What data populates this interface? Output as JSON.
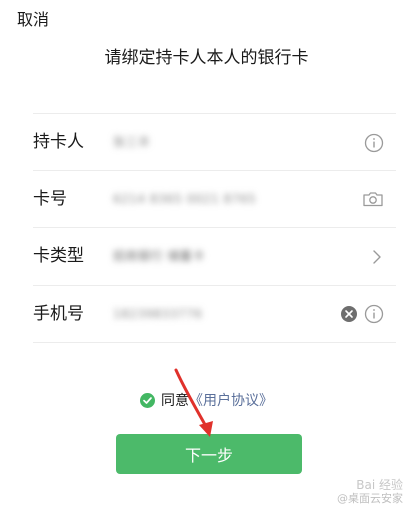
{
  "header": {
    "cancel_label": "取消",
    "title": "请绑定持卡人本人的银行卡"
  },
  "form": {
    "rows": [
      {
        "label": "持卡人",
        "value": "张三丰",
        "trailing_icons": [
          "info-icon"
        ]
      },
      {
        "label": "卡号",
        "value": "6214 8365 0021 8765",
        "trailing_icons": [
          "camera-icon"
        ]
      },
      {
        "label": "卡类型",
        "value": "招商银行 储蓄卡",
        "trailing_icons": [
          "chevron-right-icon"
        ]
      },
      {
        "label": "手机号",
        "value": "18239833776",
        "trailing_icons": [
          "clear-icon",
          "info-icon"
        ]
      }
    ]
  },
  "agreement": {
    "checked": true,
    "text": "同意",
    "link_label": "《用户协议》"
  },
  "next_button": {
    "label": "下一步"
  },
  "watermark": {
    "line1": "Bai 经验",
    "line2": "@桌面云安家"
  },
  "colors": {
    "accent_green": "#4cba6a",
    "link_blue": "#5a6f9a",
    "annotation_red": "#e0312b"
  }
}
